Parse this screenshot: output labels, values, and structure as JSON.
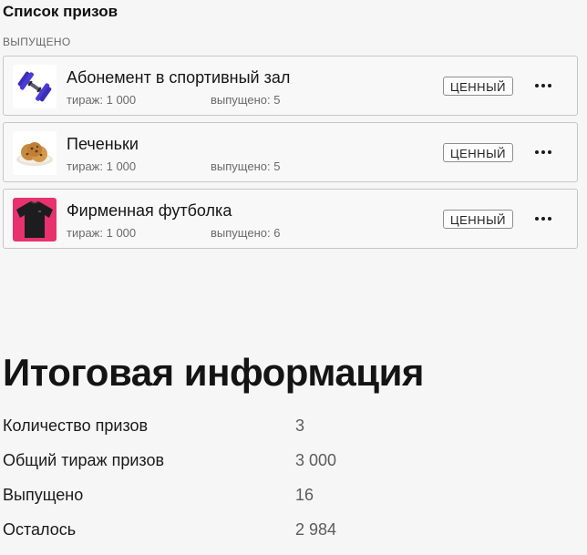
{
  "page": {
    "title": "Список призов",
    "section": "ВЫПУЩЕНО"
  },
  "prizes": [
    {
      "name": "Абонемент в спортивный зал",
      "run": "тираж: 1 000",
      "issued": "выпущено: 5",
      "badge": "ЦЕННЫЙ",
      "icon": "dumbbell-icon"
    },
    {
      "name": "Печеньки",
      "run": "тираж: 1 000",
      "issued": "выпущено: 5",
      "badge": "ЦЕННЫЙ",
      "icon": "cookies-icon"
    },
    {
      "name": "Фирменная футболка",
      "run": "тираж: 1 000",
      "issued": "выпущено: 6",
      "badge": "ЦЕННЫЙ",
      "icon": "tshirt-icon"
    }
  ],
  "summary": {
    "title": "Итоговая информация",
    "rows": [
      {
        "label": "Количество призов",
        "value": "3"
      },
      {
        "label": "Общий тираж призов",
        "value": "3 000"
      },
      {
        "label": "Выпущено",
        "value": "16"
      },
      {
        "label": "Осталось",
        "value": "2 984"
      }
    ]
  },
  "colors": {
    "background": "#f6f6f6",
    "border": "#c6c6c6",
    "tshirt_bg": "#e8326e"
  }
}
